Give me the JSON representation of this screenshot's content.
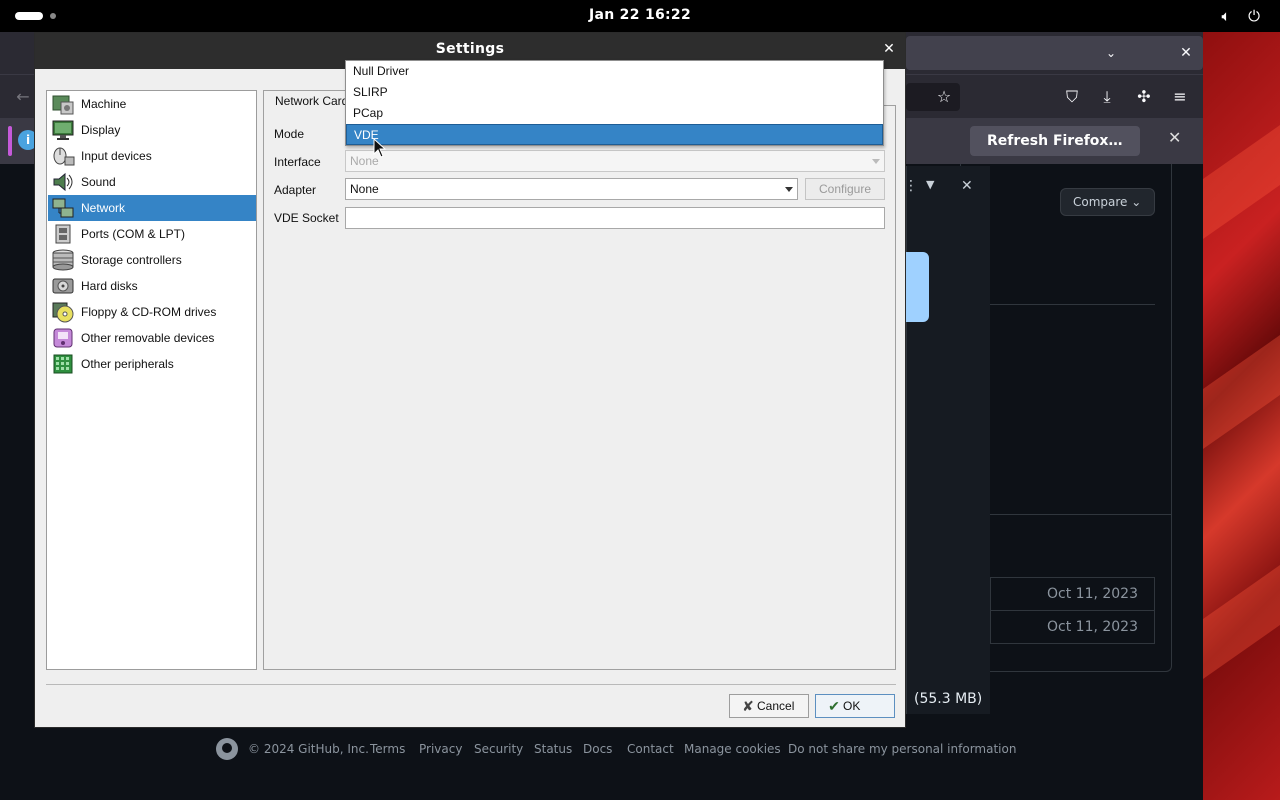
{
  "topbar": {
    "clock": "Jan 22  16:22",
    "volume_icon": "volume-icon",
    "power_icon": "power-icon"
  },
  "firefox": {
    "notification_button": "Refresh Firefox…",
    "info_icon": "i",
    "close_glyph": "✕"
  },
  "github": {
    "compare_label": "Compare",
    "dates": [
      "Oct 11, 2023",
      "Oct 11, 2023"
    ],
    "size": "(55.3 MB)",
    "footer": {
      "copyright": "© 2024 GitHub, Inc.",
      "links": [
        "Terms",
        "Privacy",
        "Security",
        "Status",
        "Docs",
        "Contact",
        "Manage cookies",
        "Do not share my personal information"
      ]
    }
  },
  "dialog": {
    "title": "Settings",
    "close": "✕",
    "categories": [
      {
        "label": "Machine",
        "icon": "machine-icon"
      },
      {
        "label": "Display",
        "icon": "display-icon"
      },
      {
        "label": "Input devices",
        "icon": "input-devices-icon"
      },
      {
        "label": "Sound",
        "icon": "sound-icon"
      },
      {
        "label": "Network",
        "icon": "network-icon",
        "selected": true
      },
      {
        "label": "Ports (COM & LPT)",
        "icon": "ports-icon"
      },
      {
        "label": "Storage controllers",
        "icon": "storage-icon"
      },
      {
        "label": "Hard disks",
        "icon": "hard-disk-icon"
      },
      {
        "label": "Floppy & CD-ROM drives",
        "icon": "cdrom-icon"
      },
      {
        "label": "Other removable devices",
        "icon": "removable-icon"
      },
      {
        "label": "Other peripherals",
        "icon": "peripherals-icon"
      }
    ],
    "tab_label": "Network Card",
    "form": {
      "mode_label": "Mode",
      "interface_label": "Interface",
      "interface_value": "None",
      "adapter_label": "Adapter",
      "adapter_value": "None",
      "configure_label": "Configure",
      "vde_socket_label": "VDE Socket",
      "vde_socket_value": ""
    },
    "mode_options": [
      "Null Driver",
      "SLIRP",
      "PCap",
      "VDE"
    ],
    "mode_selected": "VDE",
    "buttons": {
      "cancel": "Cancel",
      "ok": "OK"
    }
  },
  "colors": {
    "selection": "#3584c6",
    "titlebar": "#2d2d2d",
    "dialog_bg": "#efefef"
  }
}
